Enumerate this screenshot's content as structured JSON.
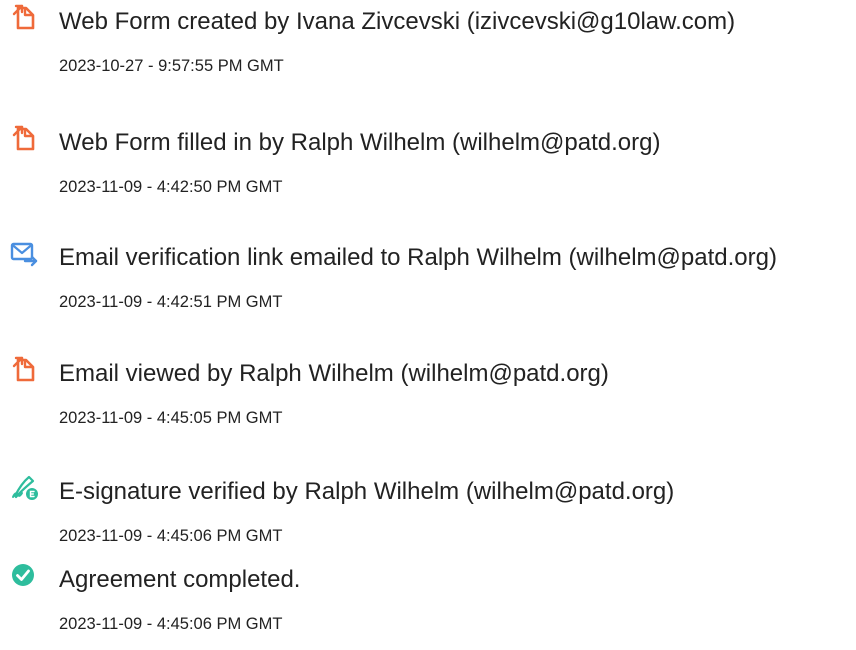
{
  "colors": {
    "document_icon": "#ef6a3a",
    "email_icon": "#4a8fe0",
    "signature_icon": "#2ebd9d",
    "check_icon": "#2ebd9d",
    "text": "#222222"
  },
  "events": [
    {
      "icon": "document-icon",
      "title": "Web Form created by Ivana Zivcevski (izivcevski@g10law.com)",
      "timestamp": "2023-10-27 - 9:57:55 PM GMT"
    },
    {
      "icon": "document-icon",
      "title": "Web Form filled in by Ralph Wilhelm (wilhelm@patd.org)",
      "timestamp": "2023-11-09 - 4:42:50 PM GMT"
    },
    {
      "icon": "email-icon",
      "title": "Email verification link emailed to Ralph Wilhelm (wilhelm@patd.org)",
      "timestamp": "2023-11-09 - 4:42:51 PM GMT"
    },
    {
      "icon": "document-icon",
      "title": "Email viewed by Ralph Wilhelm (wilhelm@patd.org)",
      "timestamp": "2023-11-09 - 4:45:05 PM GMT"
    },
    {
      "icon": "e-signature-icon",
      "title": "E-signature verified by Ralph Wilhelm (wilhelm@patd.org)",
      "timestamp": "2023-11-09 - 4:45:06 PM GMT"
    },
    {
      "icon": "check-circle-icon",
      "title": "Agreement completed.",
      "timestamp": "2023-11-09 - 4:45:06 PM GMT"
    }
  ]
}
